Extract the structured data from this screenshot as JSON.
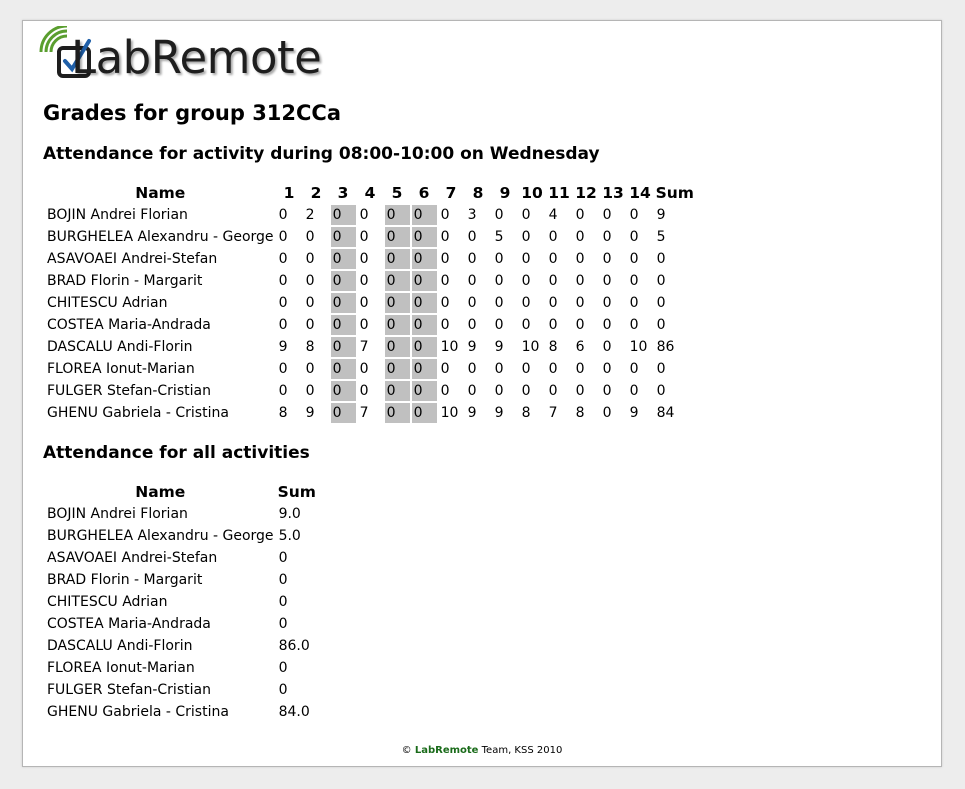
{
  "logo": {
    "text": "LabRemote",
    "accent_color": "#5a9e2f"
  },
  "title": "Grades for group 312CCa",
  "activity": {
    "heading": "Attendance for activity during 08:00-10:00 on Wednesday",
    "headers": [
      "Name",
      "1",
      "2",
      "3",
      "4",
      "5",
      "6",
      "7",
      "8",
      "9",
      "10",
      "11",
      "12",
      "13",
      "14",
      "Sum"
    ],
    "highlight_columns": [
      3,
      5,
      6
    ],
    "highlight_color": "#c0c0c0",
    "rows": [
      [
        "BOJIN Andrei Florian",
        "0",
        "2",
        "0",
        "0",
        "0",
        "0",
        "0",
        "3",
        "0",
        "0",
        "4",
        "0",
        "0",
        "0",
        "9"
      ],
      [
        "BURGHELEA Alexandru - George",
        "0",
        "0",
        "0",
        "0",
        "0",
        "0",
        "0",
        "0",
        "5",
        "0",
        "0",
        "0",
        "0",
        "0",
        "5"
      ],
      [
        "ASAVOAEI Andrei-Stefan",
        "0",
        "0",
        "0",
        "0",
        "0",
        "0",
        "0",
        "0",
        "0",
        "0",
        "0",
        "0",
        "0",
        "0",
        "0"
      ],
      [
        "BRAD Florin - Margarit",
        "0",
        "0",
        "0",
        "0",
        "0",
        "0",
        "0",
        "0",
        "0",
        "0",
        "0",
        "0",
        "0",
        "0",
        "0"
      ],
      [
        "CHITESCU Adrian",
        "0",
        "0",
        "0",
        "0",
        "0",
        "0",
        "0",
        "0",
        "0",
        "0",
        "0",
        "0",
        "0",
        "0",
        "0"
      ],
      [
        "COSTEA Maria-Andrada",
        "0",
        "0",
        "0",
        "0",
        "0",
        "0",
        "0",
        "0",
        "0",
        "0",
        "0",
        "0",
        "0",
        "0",
        "0"
      ],
      [
        "DASCALU Andi-Florin",
        "9",
        "8",
        "0",
        "7",
        "0",
        "0",
        "10",
        "9",
        "9",
        "10",
        "8",
        "6",
        "0",
        "10",
        "86"
      ],
      [
        "FLOREA Ionut-Marian",
        "0",
        "0",
        "0",
        "0",
        "0",
        "0",
        "0",
        "0",
        "0",
        "0",
        "0",
        "0",
        "0",
        "0",
        "0"
      ],
      [
        "FULGER Stefan-Cristian",
        "0",
        "0",
        "0",
        "0",
        "0",
        "0",
        "0",
        "0",
        "0",
        "0",
        "0",
        "0",
        "0",
        "0",
        "0"
      ],
      [
        "GHENU Gabriela - Cristina",
        "8",
        "9",
        "0",
        "7",
        "0",
        "0",
        "10",
        "9",
        "9",
        "8",
        "7",
        "8",
        "0",
        "9",
        "84"
      ]
    ]
  },
  "all": {
    "heading": "Attendance for all activities",
    "headers": [
      "Name",
      "Sum"
    ],
    "rows": [
      [
        "BOJIN Andrei Florian",
        "9.0"
      ],
      [
        "BURGHELEA Alexandru - George",
        "5.0"
      ],
      [
        "ASAVOAEI Andrei-Stefan",
        "0"
      ],
      [
        "BRAD Florin - Margarit",
        "0"
      ],
      [
        "CHITESCU Adrian",
        "0"
      ],
      [
        "COSTEA Maria-Andrada",
        "0"
      ],
      [
        "DASCALU Andi-Florin",
        "86.0"
      ],
      [
        "FLOREA Ionut-Marian",
        "0"
      ],
      [
        "FULGER Stefan-Cristian",
        "0"
      ],
      [
        "GHENU Gabriela - Cristina",
        "84.0"
      ]
    ]
  },
  "footer": {
    "prefix": "© ",
    "brand": "LabRemote",
    "suffix": " Team, KSS 2010",
    "brand_color": "#1a6b1a"
  }
}
